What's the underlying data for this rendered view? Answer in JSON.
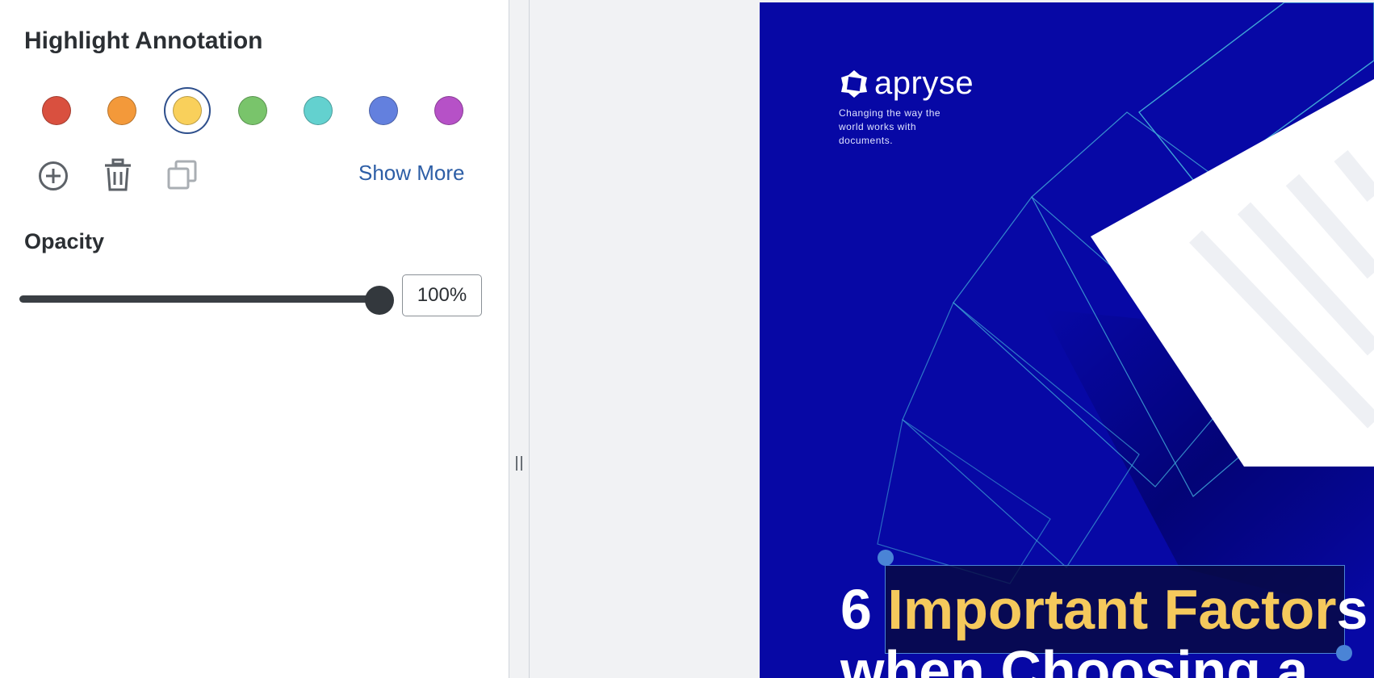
{
  "panel": {
    "title": "Highlight Annotation",
    "swatches": [
      {
        "name": "red",
        "color": "#d9503f"
      },
      {
        "name": "orange",
        "color": "#f3993a"
      },
      {
        "name": "yellow",
        "color": "#f9d05b",
        "selected": true
      },
      {
        "name": "green",
        "color": "#79c46b"
      },
      {
        "name": "teal",
        "color": "#63d1cf"
      },
      {
        "name": "blue",
        "color": "#6380de"
      },
      {
        "name": "purple",
        "color": "#b651c7"
      }
    ],
    "tools": [
      "add-color-icon",
      "delete-icon",
      "copy-icon"
    ],
    "show_more": "Show More",
    "opacity_label": "Opacity",
    "opacity_value": 1.0,
    "opacity_text": "100%"
  },
  "document": {
    "brand": "apryse",
    "tagline": "Changing the way the world works with documents.",
    "heading_prefix": "6 ",
    "heading_highlight": "Important Factor",
    "heading_suffix": "s",
    "heading_line2": "when Choosing a",
    "colors": {
      "page": "#0708a5",
      "highlight_text": "#f5c95c",
      "selection": "#4a84d6"
    }
  }
}
